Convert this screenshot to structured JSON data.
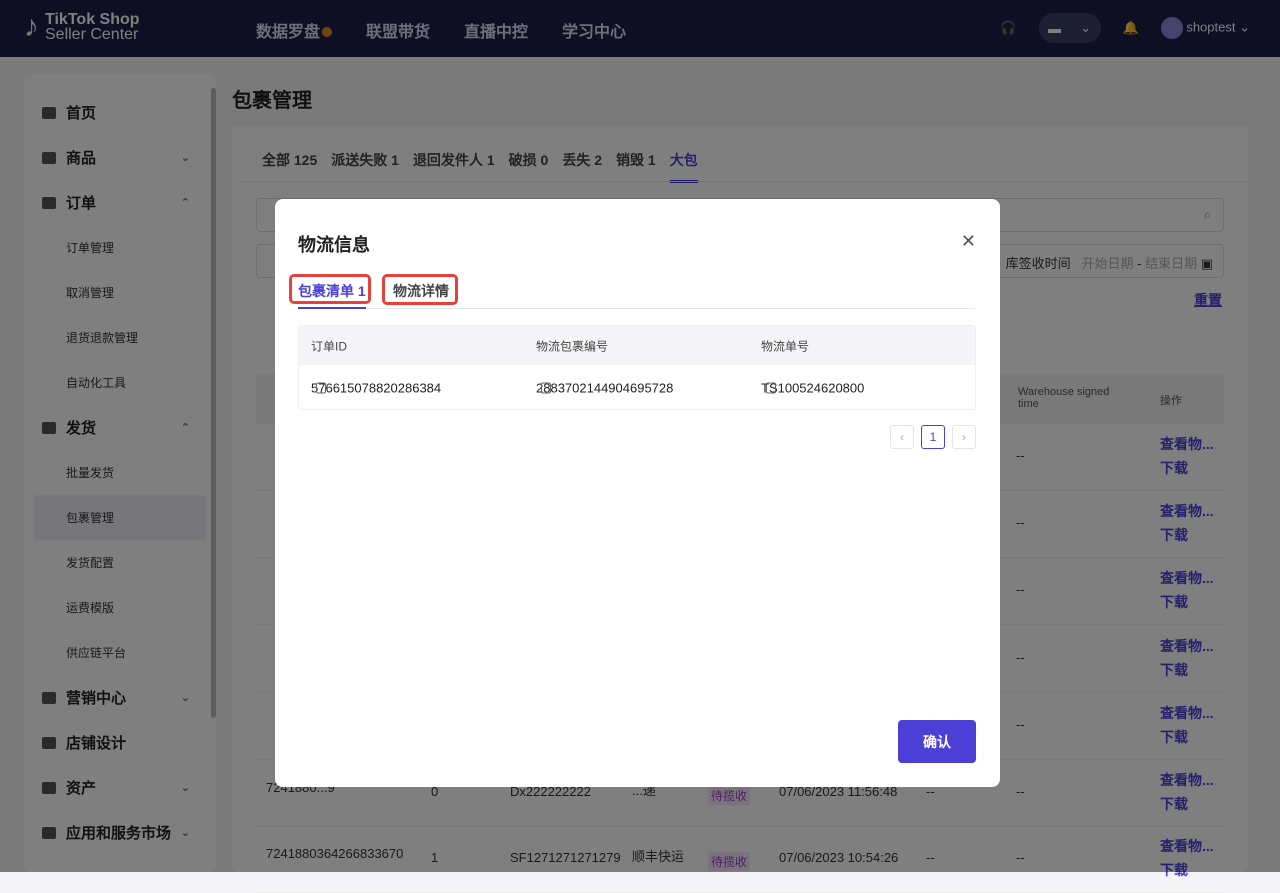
{
  "header": {
    "logo_line1": "TikTok Shop",
    "logo_line2": "Seller Center",
    "nav": [
      "数据罗盘",
      "联盟带货",
      "直播中控",
      "学习中心"
    ],
    "user": "shoptest"
  },
  "sidebar": {
    "items": [
      {
        "label": "首页"
      },
      {
        "label": "商品"
      },
      {
        "label": "订单",
        "children": [
          "订单管理",
          "取消管理",
          "退货退款管理",
          "自动化工具"
        ]
      },
      {
        "label": "发货",
        "children": [
          "批量发货",
          "包裹管理",
          "发货配置",
          "运费模版",
          "供应链平台"
        ]
      },
      {
        "label": "营销中心"
      },
      {
        "label": "店铺设计"
      },
      {
        "label": "资产"
      },
      {
        "label": "应用和服务市场"
      }
    ],
    "active": "包裹管理"
  },
  "page": {
    "title": "包裹管理",
    "tabs": [
      "全部 125",
      "派送失败 1",
      "退回发件人 1",
      "破损 0",
      "丢失 2",
      "销毁 1",
      "大包"
    ],
    "active_tab": "大包",
    "filter_label": "库签收时间",
    "start_placeholder": "开始日期",
    "end_placeholder": "结束日期",
    "reset": "重置",
    "columns": {
      "warehouse_signed": "Warehouse signed time",
      "action": "操作"
    },
    "row_actions": {
      "view": "查看物...",
      "download": "下载"
    },
    "rows": [
      {
        "id": "7241880...9",
        "qty": "0",
        "tracking": "Dx222222222",
        "carrier": "...递",
        "status": "待揽收",
        "time": "07/06/2023 11:56:48",
        "c1": "--",
        "c2": "--"
      },
      {
        "id": "7241880364266833670",
        "qty": "1",
        "tracking": "SF1271271271279",
        "carrier": "顺丰快运",
        "status": "待揽收",
        "time": "07/06/2023 10:54:26",
        "c1": "--",
        "c2": "--"
      }
    ]
  },
  "modal": {
    "title": "物流信息",
    "tabs": [
      "包裹清单 1",
      "物流详情"
    ],
    "active_tab": "包裹清单 1",
    "columns": [
      "订单ID",
      "物流包裹编号",
      "物流单号"
    ],
    "rows": [
      [
        "576615078820286384",
        "2883702144904695728",
        "TS100524620800"
      ]
    ],
    "page": "1",
    "confirm": "确认"
  },
  "colors": {
    "accent": "#4c3fd6",
    "header_bg": "#1c1f46",
    "highlight": "#e8413c"
  }
}
